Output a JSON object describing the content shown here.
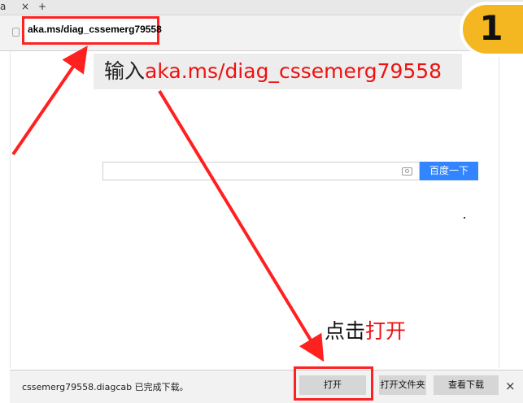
{
  "browser": {
    "tab_partial_char": "а",
    "tab_close_glyph": "×",
    "new_tab_glyph": "+",
    "address_url": "aka.ms/diag_cssemerg79558"
  },
  "annotation": {
    "step_number": "1",
    "instruction_prefix": "输入",
    "instruction_url": "aka.ms/diag_cssemerg79558",
    "click_prefix": "点击",
    "click_target": "打开",
    "highlight_color": "#ff2020",
    "badge_color": "#f4b722"
  },
  "search": {
    "button_label": "百度一下",
    "button_color": "#3385ff",
    "camera_icon": "camera-icon"
  },
  "download_bar": {
    "message": "cssemerg79558.diagcab 已完成下载。",
    "open_label": "打开",
    "open_folder_label": "打开文件夹",
    "view_downloads_label": "查看下载",
    "close_glyph": "×"
  }
}
